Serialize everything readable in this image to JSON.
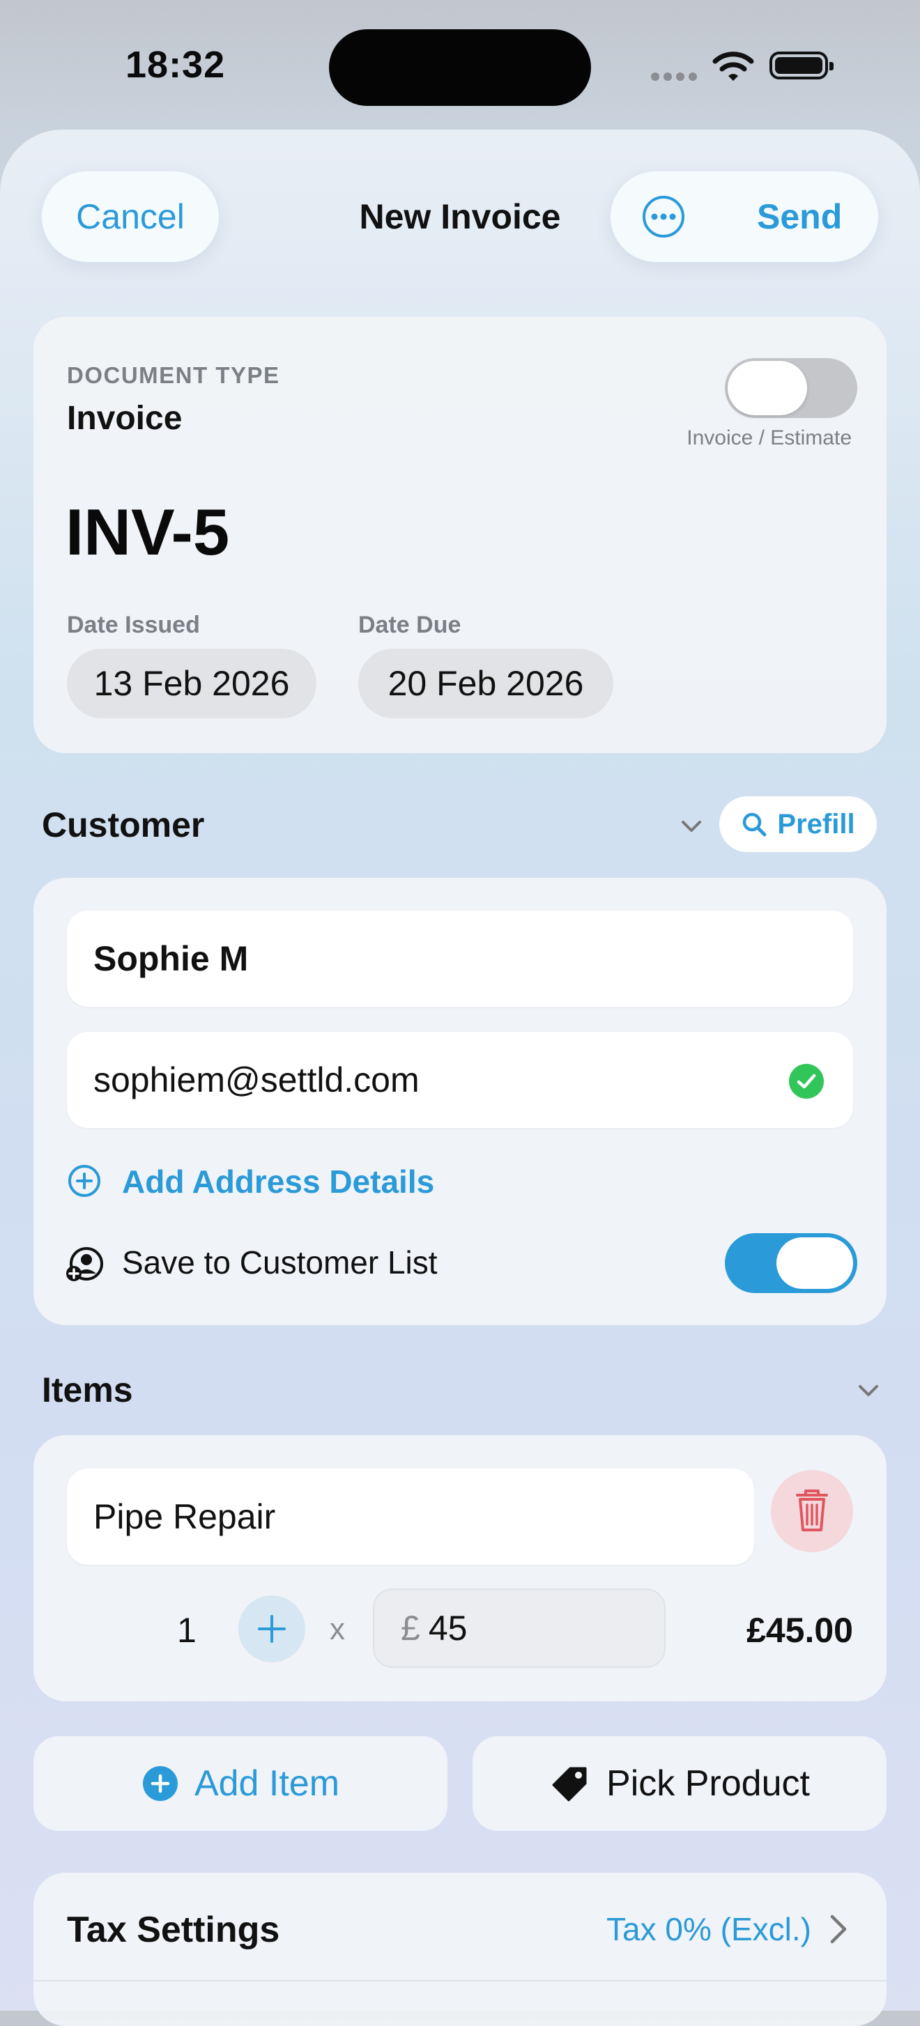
{
  "status_bar": {
    "time": "18:32"
  },
  "nav": {
    "cancel_label": "Cancel",
    "title": "New Invoice",
    "send_label": "Send"
  },
  "document": {
    "type_label": "DOCUMENT TYPE",
    "type_value": "Invoice",
    "toggle_caption": "Invoice / Estimate",
    "toggle_on": false,
    "number": "INV-5",
    "date_issued_label": "Date Issued",
    "date_issued": "13 Feb 2026",
    "date_due_label": "Date Due",
    "date_due": "20 Feb 2026"
  },
  "customer": {
    "section_title": "Customer",
    "prefill_label": "Prefill",
    "name": "Sophie M",
    "email": "sophiem@settld.com",
    "add_address_label": "Add Address Details",
    "save_label": "Save to Customer List",
    "save_toggle_on": true
  },
  "items": {
    "section_title": "Items",
    "rows": [
      {
        "name": "Pipe Repair",
        "quantity": "1",
        "times": "x",
        "currency": "£",
        "price": "45",
        "total": "£45.00"
      }
    ],
    "add_item_label": "Add Item",
    "pick_product_label": "Pick Product"
  },
  "tax": {
    "label": "Tax Settings",
    "value": "Tax 0% (Excl.)"
  },
  "colors": {
    "accent": "#2a9ad8",
    "success": "#32c55a",
    "danger": "#e0565f"
  }
}
